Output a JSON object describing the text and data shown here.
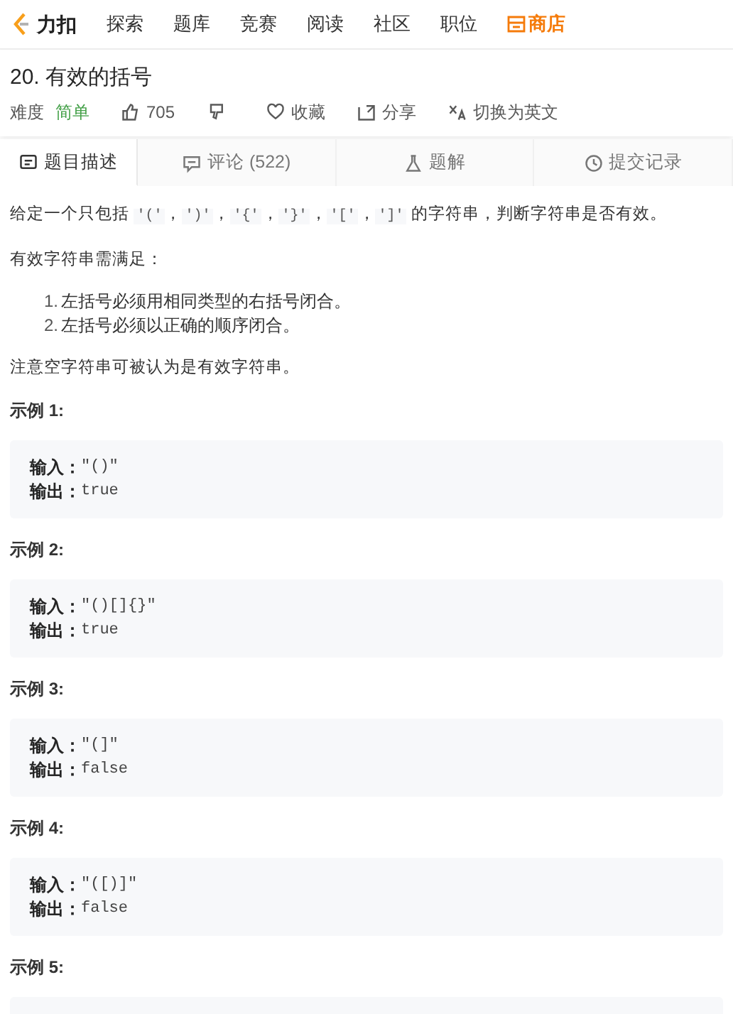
{
  "nav": {
    "logo": "力扣",
    "items": [
      {
        "label": "探索",
        "kind": "link"
      },
      {
        "label": "题库",
        "kind": "link"
      },
      {
        "label": "竞赛",
        "kind": "link"
      },
      {
        "label": "阅读",
        "kind": "link"
      },
      {
        "label": "社区",
        "kind": "link"
      },
      {
        "label": "职位",
        "kind": "link"
      },
      {
        "label": "商店",
        "kind": "store"
      }
    ]
  },
  "problem": {
    "title": "20. 有效的括号",
    "difficulty_label": "难度",
    "difficulty": "简单",
    "likes": "705",
    "favorite": "收藏",
    "share": "分享",
    "translate": "切换为英文"
  },
  "tabs": [
    {
      "label": "题目描述",
      "kind": "doc",
      "selected": true
    },
    {
      "label": "评论 (522)",
      "kind": "comment",
      "selected": false
    },
    {
      "label": "题解",
      "kind": "flask",
      "selected": false
    },
    {
      "label": "提交记录",
      "kind": "clock",
      "selected": false
    }
  ],
  "description": [
    {
      "kind": "paragraph",
      "parts": [
        {
          "kind": "text",
          "text": "给定一个只包括 "
        },
        {
          "kind": "code",
          "text": "'('"
        },
        {
          "kind": "text",
          "text": "，"
        },
        {
          "kind": "code",
          "text": "')'"
        },
        {
          "kind": "text",
          "text": "，"
        },
        {
          "kind": "code",
          "text": "'{'"
        },
        {
          "kind": "text",
          "text": "，"
        },
        {
          "kind": "code",
          "text": "'}'"
        },
        {
          "kind": "text",
          "text": "，"
        },
        {
          "kind": "code",
          "text": "'['"
        },
        {
          "kind": "text",
          "text": "，"
        },
        {
          "kind": "code",
          "text": "']'"
        },
        {
          "kind": "text",
          "text": " 的字符串，判断字符串是否有效。"
        }
      ]
    },
    {
      "kind": "paragraph",
      "parts": [
        {
          "kind": "text",
          "text": "有效字符串需满足："
        }
      ]
    },
    {
      "kind": "list",
      "items": [
        {
          "number": "1.",
          "text": "左括号必须用相同类型的右括号闭合。"
        },
        {
          "number": "2.",
          "text": "左括号必须以正确的顺序闭合。"
        }
      ]
    },
    {
      "kind": "paragraph",
      "parts": [
        {
          "kind": "text",
          "text": "注意空字符串可被认为是有效字符串。"
        }
      ]
    }
  ],
  "examples": [
    {
      "title": "示例 1:",
      "lines": [
        {
          "label": "输入：",
          "value": "\"()\""
        },
        {
          "label": "输出：",
          "value": "true"
        }
      ]
    },
    {
      "title": "示例 2:",
      "lines": [
        {
          "label": "输入：",
          "value": "\"()[]{}\""
        },
        {
          "label": "输出：",
          "value": "true"
        }
      ]
    },
    {
      "title": "示例 3:",
      "lines": [
        {
          "label": "输入：",
          "value": "\"(]\""
        },
        {
          "label": "输出：",
          "value": "false"
        }
      ]
    },
    {
      "title": "示例 4:",
      "lines": [
        {
          "label": "输入：",
          "value": "\"([)]\""
        },
        {
          "label": "输出：",
          "value": "false"
        }
      ]
    },
    {
      "title": "示例 5:"
    }
  ]
}
